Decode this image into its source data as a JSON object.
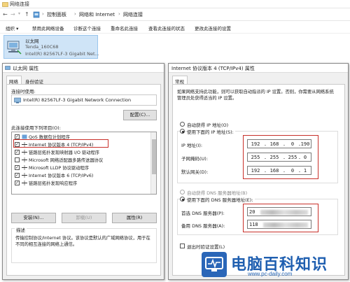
{
  "window": {
    "title": "网络连接"
  },
  "address": {
    "back": "←",
    "forward": "→",
    "up": "↑",
    "crumbs": [
      "控制面板",
      "网络和 Internet",
      "网络连接"
    ],
    "sep": "›"
  },
  "toolbar": {
    "organize": "组织 ▾",
    "items": [
      "禁用此网络设备",
      "诊断这个连接",
      "重命名此连接",
      "查看此连接的状态",
      "更改此连接的设置"
    ]
  },
  "adapter": {
    "name": "以太网",
    "network": "Tenda_160C68",
    "device": "Intel(R) 82567LF-3 Gigabit Net..."
  },
  "props": {
    "title": "以太网 属性",
    "tabs": [
      "网络",
      "身份验证"
    ],
    "connect_using_label": "连接时使用:",
    "nic": "Intel(R) 82567LF-3 Gigabit Network Connection",
    "configure": "配置(C)...",
    "items_label": "此连接使用下列项目(O):",
    "items": [
      {
        "checked": true,
        "text": "QoS 数据包计划程序"
      },
      {
        "checked": true,
        "text": "Internet 协议版本 4 (TCP/IPv4)"
      },
      {
        "checked": true,
        "text": "链路层拓扑发现映射器 I/O 驱动程序"
      },
      {
        "checked": false,
        "text": "Microsoft 网络适配器多路传送器协议"
      },
      {
        "checked": true,
        "text": "Microsoft LLDP 协议驱动程序"
      },
      {
        "checked": true,
        "text": "Internet 协议版本 6 (TCP/IPv6)"
      },
      {
        "checked": true,
        "text": "链路层拓扑发现响应程序"
      }
    ],
    "install": "安装(N)...",
    "uninstall": "卸载(U)",
    "properties": "属性(R)",
    "desc_label": "描述",
    "desc_text": "传输控制协议/Internet 协议。该协议是默认的广域网络协议，用于在不同的相互连接的网络上通信。"
  },
  "ipv4": {
    "title": "Internet 协议版本 4 (TCP/IPv4) 属性",
    "tab": "常规",
    "intro": "如果网络支持此功能，则可以获取自动指派的 IP 设置。否则，你需要从网络系统管理员处获得适当的 IP 设置。",
    "auto_ip": "自动获得 IP 地址(O)",
    "manual_ip": "使用下面的 IP 地址(S):",
    "ip_label": "IP 地址(I):",
    "ip": [
      "192",
      "168",
      "0",
      "190"
    ],
    "mask_label": "子网掩码(U):",
    "mask": [
      "255",
      "255",
      "255",
      "0"
    ],
    "gw_label": "默认网关(D):",
    "gw": [
      "192",
      "168",
      "0",
      "1"
    ],
    "auto_dns": "自动获得 DNS 服务器地址(B)",
    "manual_dns": "使用下面的 DNS 服务器地址(E):",
    "dns1_label": "首选 DNS 服务器(P):",
    "dns1": "20",
    "dns2_label": "备用 DNS 服务器(A):",
    "dns2": "118",
    "exit_validate": "退出时验证设置(L)",
    "dot": "."
  },
  "watermark": {
    "title": "电脑百科知识",
    "url": "www.pc-daily.com"
  },
  "colors": {
    "accent_red": "#c8302a",
    "selection": "#cfe4f7",
    "watermark_blue": "#2a66b8"
  }
}
